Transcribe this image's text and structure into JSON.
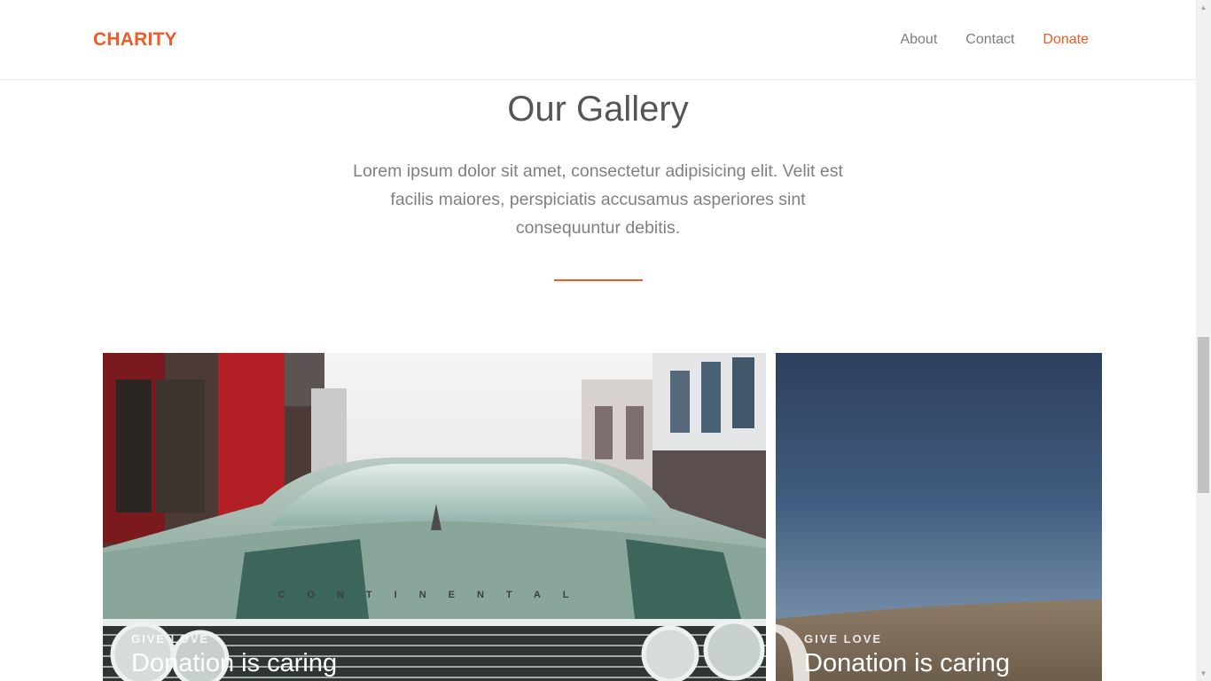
{
  "header": {
    "brand": "CHARITY",
    "nav": [
      {
        "label": "About"
      },
      {
        "label": "Contact"
      },
      {
        "label": "Donate"
      }
    ]
  },
  "gallery": {
    "title": "Our Gallery",
    "lead": "Lorem ipsum dolor sit amet, consectetur adipisicing elit. Velit est facilis maiores, perspiciatis accusamus asperiores sint consequuntur debitis."
  },
  "cards": [
    {
      "eyebrow": "GIVE LOVE",
      "heading": "Donation is caring",
      "grille_text": "CONTINENTAL"
    },
    {
      "eyebrow": "GIVE LOVE",
      "heading": "Donation is caring"
    }
  ],
  "colors": {
    "accent": "#f05a24",
    "text_dark": "#555555",
    "text_muted": "#808080"
  }
}
